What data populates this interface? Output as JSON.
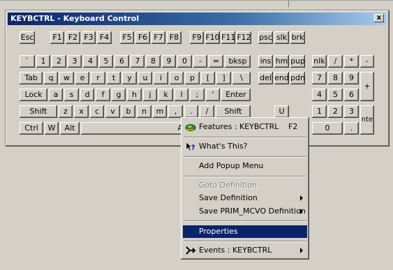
{
  "window": {
    "title": "KEYBCTRL - Keyboard Control",
    "close_label": "x"
  },
  "keys": {
    "esc": "Esc",
    "f1": "F1",
    "f2": "F2",
    "f3": "F3",
    "f4": "F4",
    "f5": "F5",
    "f6": "F6",
    "f7": "F7",
    "f8": "F8",
    "f9": "F9",
    "f10": "F10",
    "f11": "F11",
    "f12": "F12",
    "psc": "psc",
    "slk": "slk",
    "brk": "brk",
    "backtick": "`",
    "n1": "1",
    "n2": "2",
    "n3": "3",
    "n4": "4",
    "n5": "5",
    "n6": "6",
    "n7": "7",
    "n8": "8",
    "n9": "9",
    "n0": "0",
    "minus": "-",
    "equals": "=",
    "bksp": "bksp",
    "ins": "ins",
    "hm": "hm",
    "pup": "pup",
    "nlk": "nlk",
    "np_div": "/",
    "np_mul": "*",
    "np_sub": "-",
    "tab": "Tab",
    "q": "q",
    "w": "w",
    "e": "e",
    "r": "r",
    "t": "t",
    "y": "y",
    "u": "u",
    "i": "i",
    "o": "o",
    "p": "p",
    "lbracket": "[",
    "rbracket": "]",
    "backslash": "\\",
    "del": "del",
    "end": "end",
    "pdn": "pdn",
    "np7": "7",
    "np8": "8",
    "np9": "9",
    "np_add": "+",
    "lock": "Lock",
    "a": "a",
    "s": "s",
    "d": "d",
    "f": "f",
    "g": "g",
    "h": "h",
    "j": "j",
    "k": "k",
    "l": "l",
    "semicolon": ";",
    "quote": "'",
    "enter": "Enter",
    "np4": "4",
    "np5": "5",
    "np6": "6",
    "shift_l": "Shift",
    "z": "z",
    "x": "x",
    "c": "c",
    "v": "v",
    "b": "b",
    "n": "n",
    "m": "m",
    "comma": ",",
    "period": ".",
    "slash": "/",
    "shift_r": "Shift",
    "up": "U",
    "np1": "1",
    "np2": "2",
    "np3": "3",
    "ctrl": "Ctrl",
    "win": "W",
    "alt": "Alt",
    "space_partial": "A",
    "np0": "0",
    "np_dot": ".",
    "np_enter": "nte"
  },
  "context_menu": {
    "features": {
      "label": "Features : KEYBCTRL",
      "shortcut": "F2",
      "icon": "features-icon"
    },
    "whats_this": {
      "label": "What's This?",
      "icon": "whats-this-icon"
    },
    "add_popup": {
      "label": "Add Popup Menu"
    },
    "goto_definition": {
      "label": "Goto Definition",
      "disabled": true
    },
    "save_definition": {
      "label": "Save Definition"
    },
    "save_prim": {
      "label": "Save PRIM_MCVO Definition"
    },
    "properties": {
      "label": "Properties",
      "selected": true
    },
    "events": {
      "label": "Events : KEYBCTRL",
      "icon": "events-icon"
    }
  },
  "colors": {
    "face": "#d4d0c8",
    "title_start": "#0a246a",
    "title_end": "#a6caf0",
    "highlight": "#0a246a"
  }
}
